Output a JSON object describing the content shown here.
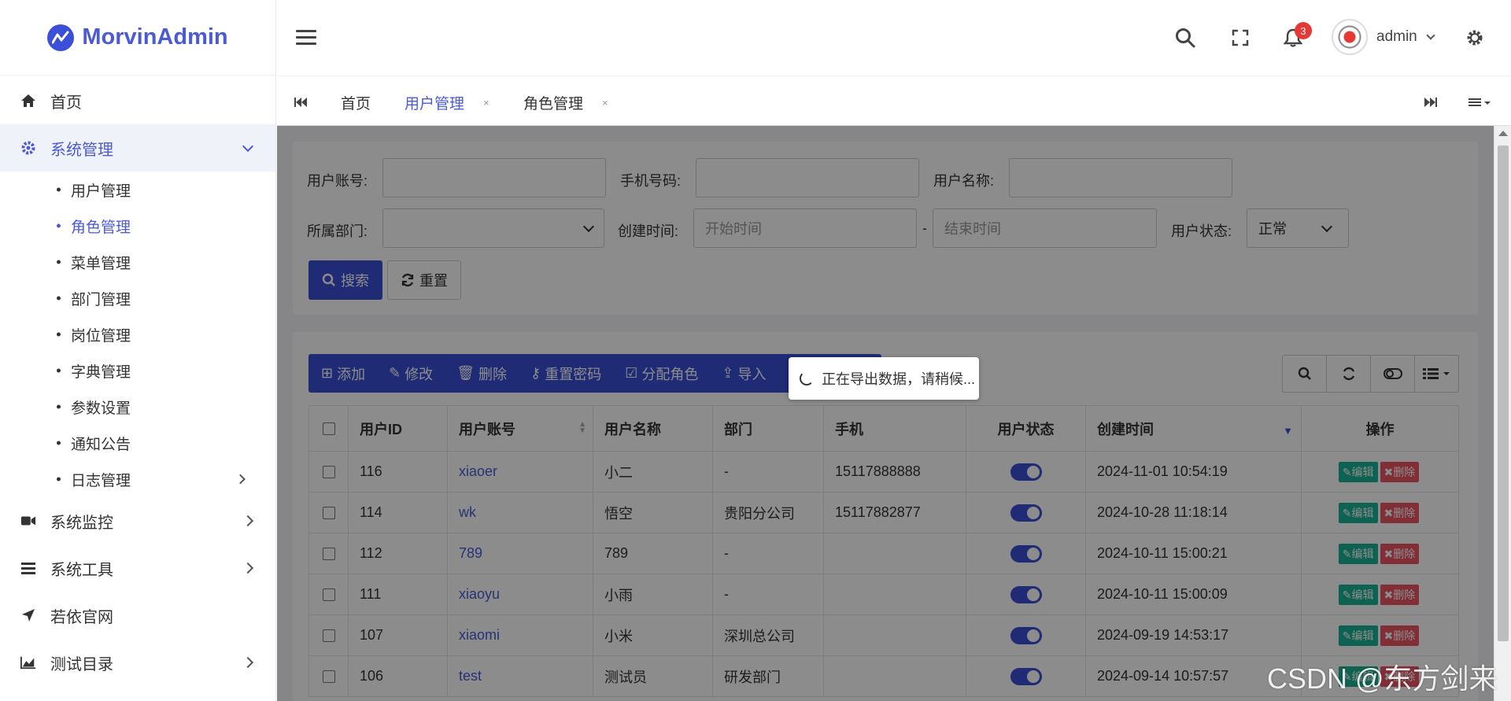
{
  "brand": {
    "name": "MorvinAdmin",
    "color": "#4a5bd4"
  },
  "sidebar": {
    "items": [
      {
        "label": "首页",
        "icon": "home-icon"
      },
      {
        "label": "系统管理",
        "icon": "gear-icon",
        "active": true,
        "children": [
          "用户管理",
          "角色管理",
          "菜单管理",
          "部门管理",
          "岗位管理",
          "字典管理",
          "参数设置",
          "通知公告",
          "日志管理"
        ],
        "active_child": "角色管理"
      },
      {
        "label": "系统监控",
        "icon": "video-icon"
      },
      {
        "label": "系统工具",
        "icon": "bars-icon"
      },
      {
        "label": "若依官网",
        "icon": "send-icon"
      },
      {
        "label": "测试目录",
        "icon": "area-chart-icon"
      }
    ]
  },
  "header": {
    "notifications": "3",
    "user": "admin"
  },
  "tabs": [
    {
      "label": "首页"
    },
    {
      "label": "用户管理",
      "active": true
    },
    {
      "label": "角色管理"
    }
  ],
  "search_form": {
    "account_label": "用户账号:",
    "phone_label": "手机号码:",
    "name_label": "用户名称:",
    "dept_label": "所属部门:",
    "time_label": "创建时间:",
    "start_placeholder": "开始时间",
    "time_sep": "-",
    "end_placeholder": "结束时间",
    "status_label": "用户状态:",
    "status_value": "正常",
    "search_btn": "搜索",
    "reset_btn": "重置"
  },
  "toolbar": {
    "add": "添加",
    "edit": "修改",
    "delete": "删除",
    "reset_pwd": "重置密码",
    "assign_role": "分配角色",
    "export": "导入"
  },
  "table": {
    "headers": [
      "用户ID",
      "用户账号",
      "用户名称",
      "部门",
      "手机",
      "用户状态",
      "创建时间",
      "操作"
    ],
    "rows": [
      {
        "id": "116",
        "account": "xiaoer",
        "name": "小二",
        "dept": "-",
        "phone": "15117888888",
        "created": "2024-11-01 10:54:19"
      },
      {
        "id": "114",
        "account": "wk",
        "name": "悟空",
        "dept": "贵阳分公司",
        "phone": "15117882877",
        "created": "2024-10-28 11:18:14"
      },
      {
        "id": "112",
        "account": "789",
        "name": "789",
        "dept": "-",
        "phone": "",
        "created": "2024-10-11 15:00:21"
      },
      {
        "id": "111",
        "account": "xiaoyu",
        "name": "小雨",
        "dept": "-",
        "phone": "",
        "created": "2024-10-11 15:00:09"
      },
      {
        "id": "107",
        "account": "xiaomi",
        "name": "小米",
        "dept": "深圳总公司",
        "phone": "",
        "created": "2024-09-19 14:53:17"
      },
      {
        "id": "106",
        "account": "test",
        "name": "测试员",
        "dept": "研发部门",
        "phone": "",
        "created": "2024-09-14 10:57:57"
      }
    ],
    "op_edit": "编辑",
    "op_delete": "删除"
  },
  "loading": {
    "text": "正在导出数据，请稍候..."
  },
  "watermark": "CSDN @东方剑来",
  "colors": {
    "primary": "#3b4fd8",
    "success": "#1ab394",
    "danger": "#ed5565"
  }
}
